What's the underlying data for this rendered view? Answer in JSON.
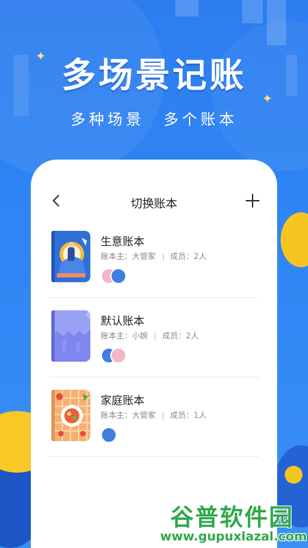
{
  "hero": {
    "title": "多场景记账",
    "subtitle_left": "多种场景",
    "subtitle_right": "多个账本"
  },
  "screen": {
    "title": "切换账本",
    "back_icon": "chevron-left-icon",
    "add_icon": "plus-icon"
  },
  "books": [
    {
      "name": "生意账本",
      "owner_label": "账本主：大管家",
      "members_label": "成员：2人"
    },
    {
      "name": "默认账本",
      "owner_label": "账本主：小婉",
      "members_label": "成员：2人"
    },
    {
      "name": "家庭账本",
      "owner_label": "账本主：大管家",
      "members_label": "成员：1人"
    }
  ],
  "watermark": {
    "cn": "谷普软件园",
    "en": "www.gupuxlazal.com"
  },
  "colors": {
    "background_blue": "#2f86f3",
    "accent_yellow": "#f7c520",
    "watermark_green": "#2fa84b"
  }
}
